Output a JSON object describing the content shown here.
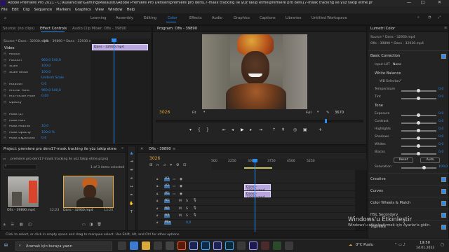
{
  "window": {
    "title": "Adobe Premiere Pro 2021 - C:\\Kullanıcılar\\Gaming\\Masaüstü\\Adobe Premiere Pro Dersleri\\premiere pro ders17-mask tracking ile yüz takip etme\\premiere pro ders17-mask tracking ile yüz takip etme.prproj *"
  },
  "menu": [
    "File",
    "Edit",
    "Clip",
    "Sequence",
    "Markers",
    "Graphics",
    "View",
    "Window",
    "Help"
  ],
  "workspaces": [
    "Learning",
    "Assembly",
    "Editing",
    "Color",
    "Effects",
    "Audio",
    "Graphics",
    "Captions",
    "Libraries",
    "Untitled Workspace"
  ],
  "workspace_active": "Color",
  "source_panel": {
    "tabs": [
      "Source: (no clips)",
      "Effect Controls",
      "Audio Clip Mixer: Ofis - 39890"
    ],
    "active_tab": "Effect Controls",
    "source_row": "Source * Dans - 32930.mp4",
    "seq_row": "Ofis - 39890 * Dans - 32930.mp4",
    "clip_label": "Dans - 32930.mp4",
    "section_video": "Video",
    "props": [
      {
        "label": "Motion",
        "value": ""
      },
      {
        "label": "Position",
        "value": "960,0    540,0"
      },
      {
        "label": "Scale",
        "value": "100,0"
      },
      {
        "label": "Scale Width",
        "value": "100,0"
      },
      {
        "label": "",
        "value": "Uniform Scale"
      },
      {
        "label": "Rotation",
        "value": "0,0"
      },
      {
        "label": "Anchor Point",
        "value": "960,0    540,0"
      },
      {
        "label": "Anti-flicker Filter",
        "value": "0,00"
      },
      {
        "label": "Opacity",
        "value": ""
      },
      {
        "label": "",
        "value": ""
      },
      {
        "label": "Mask (1)",
        "value": ""
      },
      {
        "label": "Mask Path",
        "value": ""
      },
      {
        "label": "Mask Feather",
        "value": "10,0"
      },
      {
        "label": "Mask Opacity",
        "value": "100,0 %"
      },
      {
        "label": "Mask Expansion",
        "value": "0,0"
      }
    ],
    "timecode": "00:00:07:18"
  },
  "program_panel": {
    "title": "Program: Ofis - 39890",
    "timecode": "3026",
    "fit": "Fit",
    "quality": "Full",
    "duration": "3670"
  },
  "project_panel": {
    "tabs": [
      "Project: premiere pro ders17-mask tracking ile yüz takip etme"
    ],
    "path": "premiere pro ders17-mask tracking ile yüz takip etme.prproj",
    "selection": "1 of 3 items selected",
    "items": [
      {
        "name": "Ofis - 39890.mp4",
        "duration": "12:23"
      },
      {
        "name": "Dans - 32930.mp4",
        "duration": "13:20"
      }
    ]
  },
  "timeline": {
    "tab": "Ofis - 39890",
    "timecode": "3026",
    "ruler": [
      "500",
      "2250",
      "3000",
      "3750",
      "4500",
      "5250"
    ],
    "clips": [
      "Dans - 32930.mp4",
      "Dans - 32930.mp4"
    ],
    "tracks": [
      "V3",
      "V2",
      "V1",
      "A1",
      "A2",
      "A3",
      "Mix"
    ],
    "track_flags": [
      "M",
      "S"
    ],
    "mix_value": "0,0"
  },
  "lumetri": {
    "title": "Lumetri Color",
    "source_row": "Source * Dans - 32930.mp4",
    "seq_row": "Ofis - 39890 * Dans - 32930.mp4",
    "basic": "Basic Correction",
    "input_lut_label": "Input LUT",
    "input_lut_value": "None",
    "white_balance": "White Balance",
    "wb_selector": "WB Selector",
    "rows_wb": [
      {
        "label": "Temperature",
        "value": "0,0"
      },
      {
        "label": "Tint",
        "value": "0,0"
      }
    ],
    "tone": "Tone",
    "rows_tone": [
      {
        "label": "Exposure",
        "value": "0,0"
      },
      {
        "label": "Contrast",
        "value": "0,0"
      },
      {
        "label": "Highlights",
        "value": "0,0"
      },
      {
        "label": "Shadows",
        "value": "0,0"
      },
      {
        "label": "Whites",
        "value": "0,0"
      },
      {
        "label": "Blacks",
        "value": "0,0"
      }
    ],
    "reset": "Reset",
    "auto": "Auto",
    "saturation_label": "Saturation",
    "saturation_value": "100,0",
    "sections": [
      "Creative",
      "Curves",
      "Color Wheels & Match",
      "HSL Secondary",
      "Vignette"
    ]
  },
  "status_bar": "Click to select, or click in empty space and drag to marquee select. Use Shift, Alt, and Ctrl for other options.",
  "watermark": {
    "line1": "Windows'u Etkinleştir",
    "line2": "Windows'u etkinleştirmek için Ayarlar'a gidin."
  },
  "taskbar": {
    "search_placeholder": "Aramak için buraya yazın",
    "weather": "0°C  Puslu",
    "time": "19:50",
    "date": "14.01.2023"
  },
  "colors": {
    "accent": "#2d8ceb",
    "clip": "#b9a6df",
    "playhead": "#2d8ceb"
  }
}
